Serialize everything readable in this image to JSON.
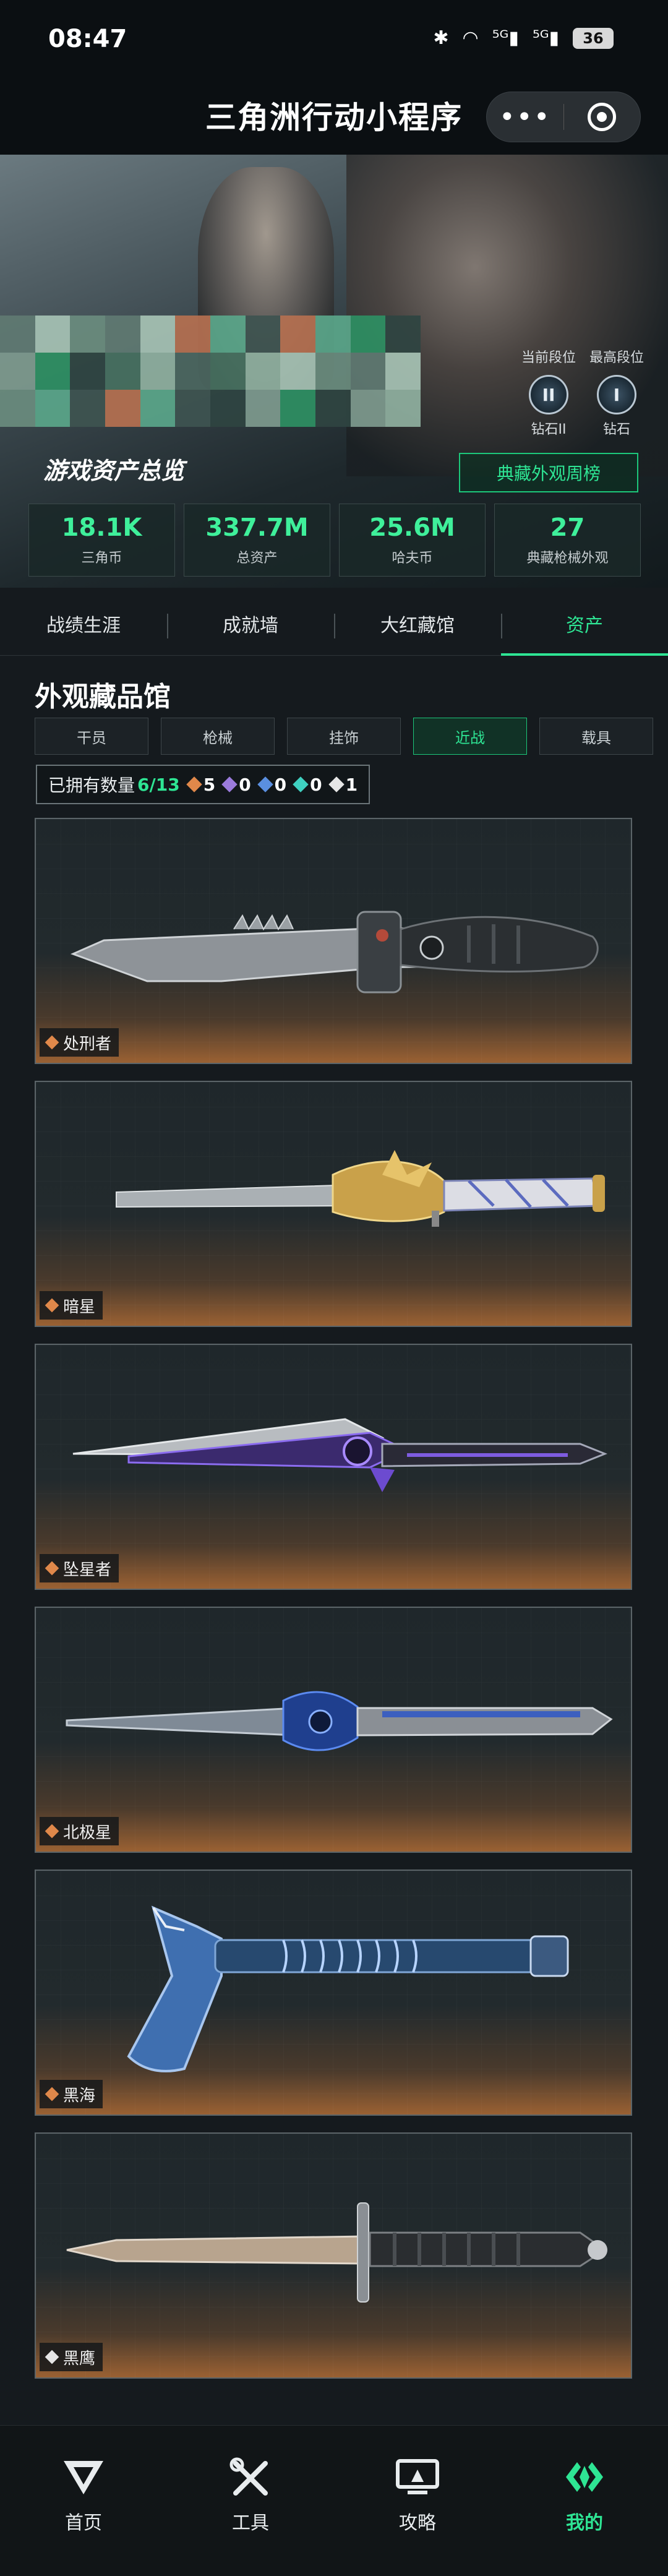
{
  "status_bar": {
    "time": "08:47",
    "icons": [
      "bluetooth-icon",
      "wifi-icon",
      "signal-5g-icon",
      "signal-5g-icon"
    ],
    "battery": "36"
  },
  "app": {
    "title": "三角洲行动小程序"
  },
  "hero": {
    "current_rank_label": "当前段位",
    "current_rank_name": "钻石II",
    "current_rank_numeral": "II",
    "best_rank_label": "最高段位",
    "best_rank_name": "钻石",
    "best_rank_numeral": "I",
    "overview_title": "游戏资产总览",
    "weekly_button": "典藏外观周榜",
    "stats": [
      {
        "value": "18.1K",
        "label": "三角币"
      },
      {
        "value": "337.7M",
        "label": "总资产"
      },
      {
        "value": "25.6M",
        "label": "哈夫币"
      },
      {
        "value": "27",
        "label": "典藏枪械外观"
      }
    ]
  },
  "tabs": [
    {
      "label": "战绩生涯",
      "active": false
    },
    {
      "label": "成就墙",
      "active": false
    },
    {
      "label": "大红藏馆",
      "active": false
    },
    {
      "label": "资产",
      "active": true
    }
  ],
  "gallery": {
    "title": "外观藏品馆",
    "categories": [
      {
        "label": "干员",
        "active": false
      },
      {
        "label": "枪械",
        "active": false
      },
      {
        "label": "挂饰",
        "active": false
      },
      {
        "label": "近战",
        "active": true
      },
      {
        "label": "载具",
        "active": false
      }
    ],
    "owned_label": "已拥有数量",
    "owned_count": "6/13",
    "rarity_counts": [
      {
        "color": "#e0884a",
        "count": "5"
      },
      {
        "color": "#9b7bdc",
        "count": "0"
      },
      {
        "color": "#5a8fe0",
        "count": "0"
      },
      {
        "color": "#3fd0c0",
        "count": "0"
      },
      {
        "color": "#e6e6e6",
        "count": "1"
      }
    ],
    "items": [
      {
        "name": "处刑者",
        "rarity_color": "#e0884a"
      },
      {
        "name": "暗星",
        "rarity_color": "#e0884a"
      },
      {
        "name": "坠星者",
        "rarity_color": "#e0884a"
      },
      {
        "name": "北极星",
        "rarity_color": "#e0884a"
      },
      {
        "name": "黑海",
        "rarity_color": "#e0884a"
      },
      {
        "name": "黑鹰",
        "rarity_color": "#e6e6e6"
      }
    ]
  },
  "bottom_nav": [
    {
      "label": "首页",
      "icon": "delta-logo-icon",
      "active": false
    },
    {
      "label": "工具",
      "icon": "tools-icon",
      "active": false
    },
    {
      "label": "攻略",
      "icon": "monitor-icon",
      "active": false
    },
    {
      "label": "我的",
      "icon": "profile-logo-icon",
      "active": true
    }
  ]
}
